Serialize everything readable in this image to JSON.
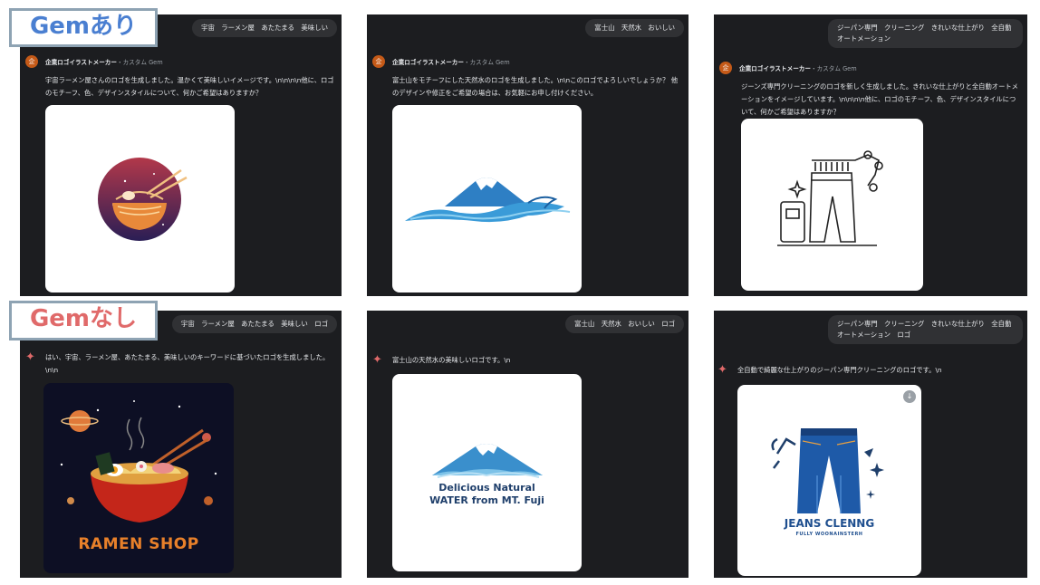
{
  "labels": {
    "gem": "Gemあり",
    "no_gem": "Gemなし"
  },
  "agent": {
    "name": "企業ロゴイラストメーカー",
    "sub": "・カスタム Gem",
    "avatar": "企"
  },
  "with_gem": [
    {
      "prompt": "宇宙　ラーメン屋　あたたまる　美味しい",
      "response": "宇宙ラーメン屋さんのロゴを生成しました。温かくて美味しいイメージです。\\n\\n\\n\\n他に、ロゴのモチーフ、色、デザインスタイルについて、何かご希望はありますか？"
    },
    {
      "prompt": "富士山　天然水　おいしい",
      "response": "富士山をモチーフにした天然水のロゴを生成しました。\\n\\nこのロゴでよろしいでしょうか？ 他のデザインや修正をご希望の場合は、お気軽にお申し付けください。"
    },
    {
      "prompt": "ジーパン専門　クリーニング　きれいな仕上がり　全自動オートメーション",
      "response": "ジーンズ専門クリーニングのロゴを新しく生成しました。きれいな仕上がりと全自動オートメーションをイメージしています。\\n\\n\\n\\n他に、ロゴのモチーフ、色、デザインスタイルについて、何かご希望はありますか？"
    }
  ],
  "without_gem": [
    {
      "prompt": "宇宙　ラーメン屋　あたたまる　美味しい　ロゴ",
      "response": "はい、宇宙、ラーメン屋、あたたまる、美味しいのキーワードに基づいたロゴを生成しました。\\n\\n",
      "logo_text": "RAMEN SHOP"
    },
    {
      "prompt": "富士山　天然水　おいしい　ロゴ",
      "response": "富士山の天然水の美味しいロゴです。\\n",
      "logo_line1": "Delicious Natural",
      "logo_line2": "WATER from MT. Fuji"
    },
    {
      "prompt": "ジーパン専門　クリーニング　きれいな仕上がり　全自動オートメーション　ロゴ",
      "response": "全自動で綺麗な仕上がりのジーパン専門クリーニングのロゴです。\\n",
      "logo_title": "JEANS CLENNG",
      "logo_sub": "FULLY WOONAINSTERH"
    }
  ],
  "icons": {
    "spark": "✦",
    "download": "↓"
  },
  "colors": {
    "panel_bg": "#1c1d20",
    "chip_bg": "#303134",
    "avatar": "#c55a18",
    "spark": "#e06a6a",
    "label_blue": "#4a7fd1",
    "label_red": "#e06a6a",
    "label_border": "#8ea3b3"
  }
}
